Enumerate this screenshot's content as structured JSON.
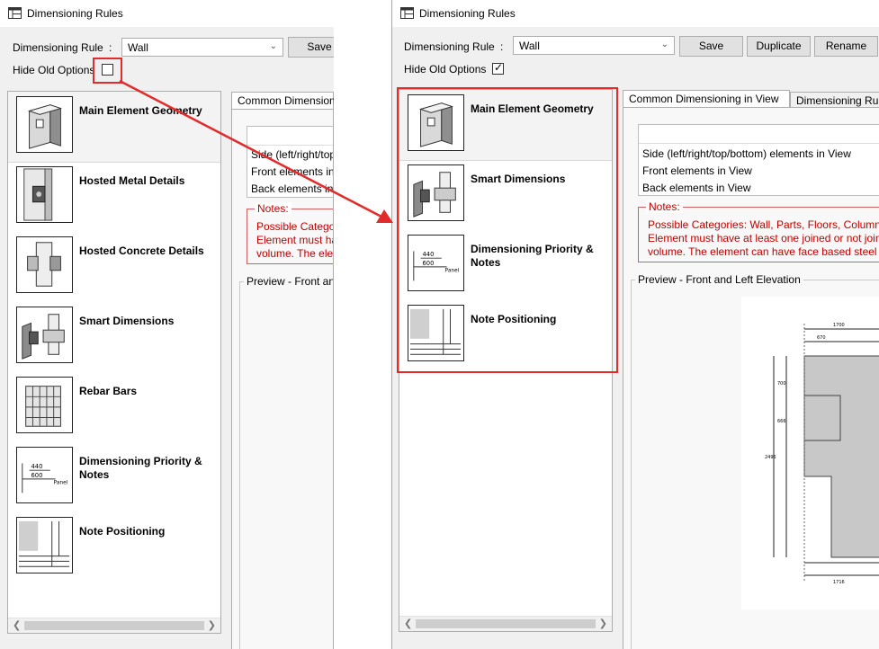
{
  "window_title": "Dimensioning Rules",
  "rule_label": "Dimensioning Rule",
  "rule_colon": ":",
  "rule_value": "Wall",
  "buttons": {
    "save": "Save",
    "duplicate": "Duplicate",
    "rename": "Rename"
  },
  "hide_old_options_label": "Hide Old Options",
  "left_items": [
    "Main Element Geometry",
    "Hosted Metal Details",
    "Hosted Concrete Details",
    "Smart Dimensions",
    "Rebar Bars",
    "Dimensioning Priority & Notes",
    "Note Positioning"
  ],
  "right_items": [
    "Main Element Geometry",
    "Smart Dimensions",
    "Dimensioning Priority & Notes",
    "Note Positioning"
  ],
  "tabs": {
    "common_left": "Common Dimension",
    "common": "Common Dimensioning in View",
    "rules": "Dimensioning Rul"
  },
  "views_left": [
    "Side (left/right/top/",
    "Front elements in",
    "Back elements in"
  ],
  "views": [
    "Side (left/right/top/bottom) elements in View",
    "Front elements in View",
    "Back elements in View"
  ],
  "notes_title": "Notes:",
  "notes_left": [
    "Possible Categor",
    "Element must ha",
    "volume. The ele"
  ],
  "notes_lines": [
    "Possible Categories: Wall, Parts, Floors, Columns,",
    "Element must have at least one joined or not joine",
    "volume. The element can have face based steel o"
  ],
  "preview_left": "Preview - Front and",
  "preview_title": "Preview - Front and Left Elevation",
  "drawing_numbers": [
    "1700",
    "670",
    "700",
    "666",
    "2495",
    "1716"
  ],
  "thumb_labels": {
    "dim1": "440",
    "dim2": "600",
    "panel": "Panel"
  }
}
